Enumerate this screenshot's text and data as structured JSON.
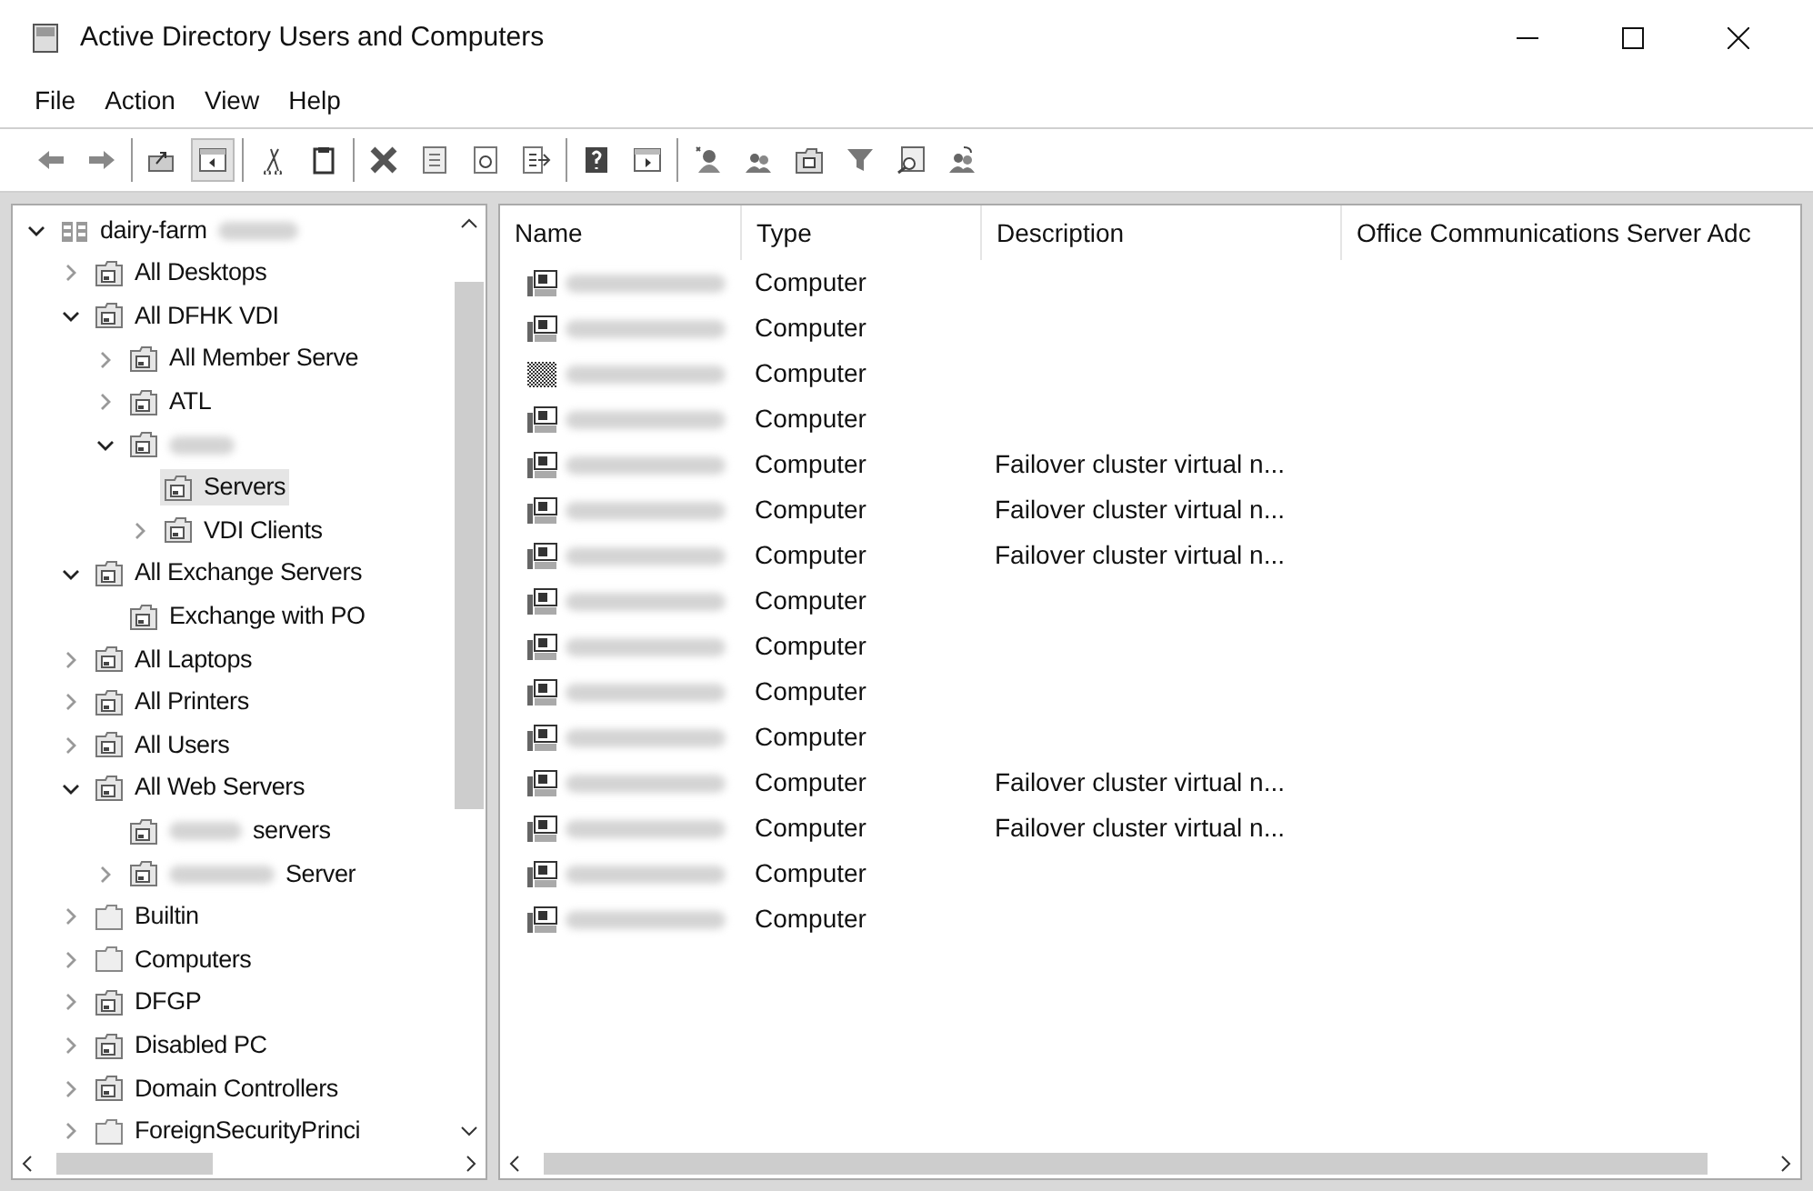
{
  "window": {
    "title": "Active Directory Users and Computers"
  },
  "menu": [
    "File",
    "Action",
    "View",
    "Help"
  ],
  "toolbar": [
    [
      {
        "kind": "back",
        "selected": false
      },
      {
        "kind": "forward",
        "selected": false
      }
    ],
    [
      {
        "kind": "up",
        "selected": false
      },
      {
        "kind": "console-tree",
        "selected": true
      }
    ],
    [
      {
        "kind": "cut",
        "selected": false
      },
      {
        "kind": "paste",
        "selected": false
      }
    ],
    [
      {
        "kind": "delete",
        "selected": false
      },
      {
        "kind": "properties",
        "selected": false
      },
      {
        "kind": "refresh",
        "selected": false
      },
      {
        "kind": "export",
        "selected": false
      }
    ],
    [
      {
        "kind": "help",
        "selected": false
      },
      {
        "kind": "action-pane",
        "selected": false
      }
    ],
    [
      {
        "kind": "new-user",
        "selected": false
      },
      {
        "kind": "new-group",
        "selected": false
      },
      {
        "kind": "new-ou",
        "selected": false
      },
      {
        "kind": "filter",
        "selected": false
      },
      {
        "kind": "find",
        "selected": false
      },
      {
        "kind": "add-to-group",
        "selected": false
      }
    ]
  ],
  "tree": [
    {
      "label": "dairy-farm",
      "kind": "domain",
      "redacted": true,
      "expanded": true,
      "selected": false,
      "children": [
        {
          "label": "All Desktops",
          "kind": "ou",
          "expanded": false,
          "selected": false
        },
        {
          "label": "All DFHK VDI",
          "kind": "ou",
          "expanded": true,
          "selected": false,
          "children": [
            {
              "label": "All Member Serve",
              "kind": "ou",
              "expanded": false,
              "selected": false
            },
            {
              "label": "ATL",
              "kind": "ou",
              "expanded": false,
              "selected": false
            },
            {
              "kind": "ou",
              "redacted": true,
              "expanded": true,
              "selected": false,
              "children": [
                {
                  "label": "Servers",
                  "kind": "ou",
                  "selected": true
                },
                {
                  "label": "VDI Clients",
                  "kind": "ou",
                  "expanded": false,
                  "selected": false
                }
              ]
            }
          ]
        },
        {
          "label": "All Exchange Servers",
          "kind": "ou",
          "expanded": true,
          "selected": false,
          "children": [
            {
              "label": "Exchange with PO",
              "kind": "ou",
              "selected": false
            }
          ]
        },
        {
          "label": "All Laptops",
          "kind": "ou",
          "expanded": false,
          "selected": false
        },
        {
          "label": "All Printers",
          "kind": "ou",
          "expanded": false,
          "selected": false
        },
        {
          "label": "All Users",
          "kind": "ou",
          "expanded": false,
          "selected": false
        },
        {
          "label": "All Web Servers",
          "kind": "ou",
          "expanded": true,
          "selected": false,
          "children": [
            {
              "label": "servers",
              "kind": "ou",
              "redacted": true,
              "selected": false
            },
            {
              "label": "Server",
              "kind": "ou",
              "redacted": true,
              "expanded": false,
              "selected": false
            }
          ]
        },
        {
          "label": "Builtin",
          "kind": "folder",
          "expanded": false,
          "selected": false
        },
        {
          "label": "Computers",
          "kind": "folder",
          "expanded": false,
          "selected": false
        },
        {
          "label": "DFGP",
          "kind": "ou",
          "expanded": false,
          "selected": false
        },
        {
          "label": "Disabled PC",
          "kind": "ou",
          "expanded": false,
          "selected": false
        },
        {
          "label": "Domain Controllers",
          "kind": "ou",
          "expanded": false,
          "selected": false
        },
        {
          "label": "ForeignSecurityPrinci",
          "kind": "folder",
          "expanded": false,
          "selected": false
        }
      ]
    }
  ],
  "table": {
    "columns": [
      "Name",
      "Type",
      "Description",
      "Office Communications Server Adc"
    ],
    "rows": [
      {
        "kind": "computer",
        "type": "Computer"
      },
      {
        "kind": "computer",
        "type": "Computer"
      },
      {
        "kind": "disabled",
        "type": "Computer"
      },
      {
        "kind": "computer",
        "type": "Computer"
      },
      {
        "kind": "computer",
        "type": "Computer",
        "description": "Failover cluster virtual n..."
      },
      {
        "kind": "computer",
        "type": "Computer",
        "description": "Failover cluster virtual n..."
      },
      {
        "kind": "computer",
        "type": "Computer",
        "description": "Failover cluster virtual n..."
      },
      {
        "kind": "computer",
        "type": "Computer"
      },
      {
        "kind": "computer",
        "type": "Computer"
      },
      {
        "kind": "computer",
        "type": "Computer"
      },
      {
        "kind": "computer",
        "type": "Computer"
      },
      {
        "kind": "computer",
        "type": "Computer",
        "description": "Failover cluster virtual n..."
      },
      {
        "kind": "computer",
        "type": "Computer",
        "description": "Failover cluster virtual n..."
      },
      {
        "kind": "computer",
        "type": "Computer"
      },
      {
        "kind": "computer",
        "type": "Computer"
      }
    ]
  }
}
